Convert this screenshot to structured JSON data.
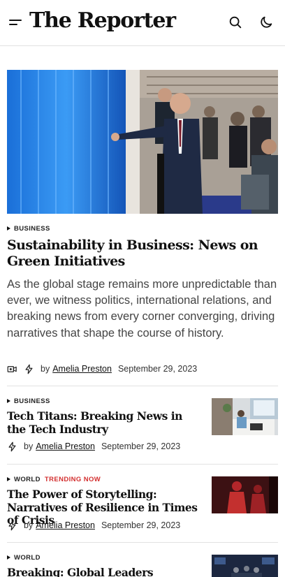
{
  "header": {
    "logo": "The Reporter",
    "menu_icon": "menu-icon",
    "search_icon": "search-icon",
    "theme_icon": "moon-icon"
  },
  "featured": {
    "category": "BUSINESS",
    "title": "Sustainability in Business: News on Green Initiatives",
    "description": "As the global stage remains more unpredictable than ever, we witness politics, international relations, and breaking news from every corner converging, driving narratives that shape the course of history.",
    "by": "by",
    "author": "Amelia Preston",
    "date": "September 29, 2023",
    "icons": [
      "video-icon",
      "lightning-icon"
    ]
  },
  "articles": [
    {
      "category": "BUSINESS",
      "title": "Tech Titans: Breaking News in the Tech Industry",
      "by": "by",
      "author": "Amelia Preston",
      "date": "September 29, 2023"
    },
    {
      "category": "WORLD",
      "tag": "TRENDING NOW",
      "title": "The Power of Storytelling: Narratives of Resilience in Times of Crisis",
      "by": "by",
      "author": "Amelia Preston",
      "date": "September 29, 2023"
    },
    {
      "category": "WORLD",
      "title": "Breaking: Global Leaders Convene"
    }
  ],
  "colors": {
    "trending": "#d32f2f",
    "text": "#111111",
    "divider": "#e2e2e2"
  }
}
